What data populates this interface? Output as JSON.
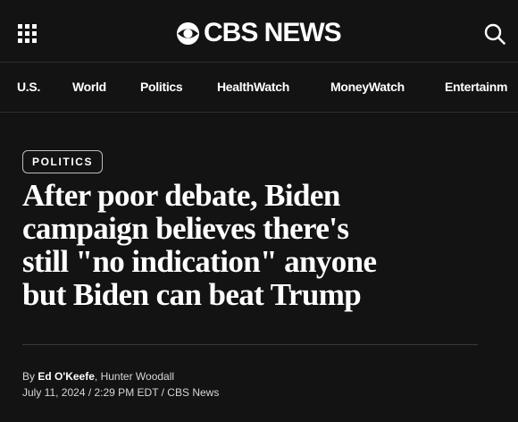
{
  "header": {
    "logo_text": "CBS NEWS",
    "menu_icon": "grid-menu-icon",
    "search_icon": "search-icon",
    "logo_icon": "cbs-eye-icon"
  },
  "nav": {
    "items": [
      "U.S.",
      "World",
      "Politics",
      "HealthWatch",
      "MoneyWatch",
      "Entertainm"
    ]
  },
  "article": {
    "section": "POLITICS",
    "headline_lines": [
      "After poor debate, Biden",
      "campaign believes there's",
      "still \"no indication\" anyone",
      "but Biden can beat Trump"
    ],
    "byline_prefix": "By ",
    "author_1": "Ed O'Keefe",
    "author_sep": ", ",
    "author_2": "Hunter Woodall",
    "dateline": "July 11, 2024 / 2:29 PM EDT / CBS News"
  },
  "colors": {
    "background": "#131313",
    "text": "#ffffff",
    "muted_text": "#d6d6d6",
    "divider": "#2e2e2e"
  }
}
